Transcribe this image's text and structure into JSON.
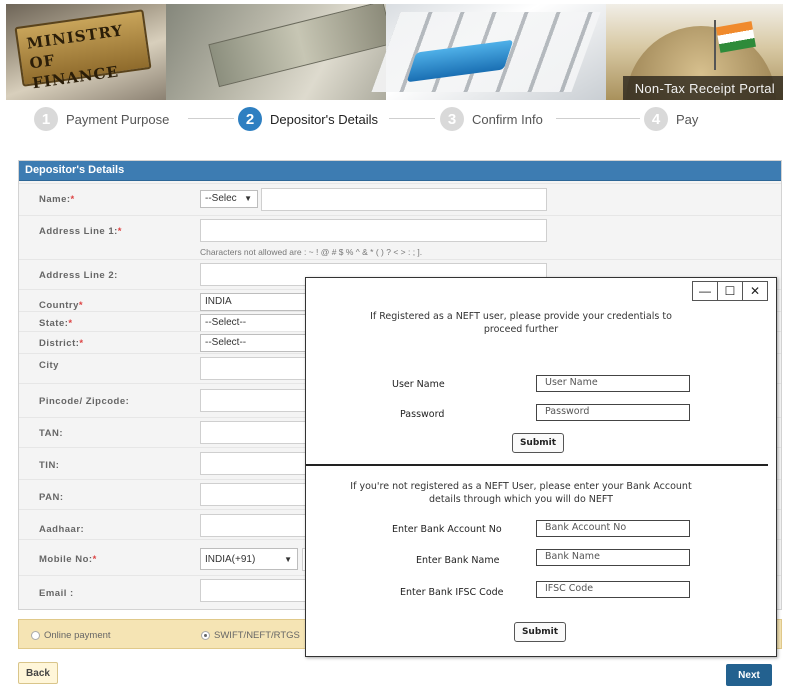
{
  "banner": {
    "plaque_text": "MINISTRY OF FINANCE",
    "portal_title": "Non-Tax Receipt Portal"
  },
  "steps": [
    {
      "number": "1",
      "label": "Payment Purpose",
      "active": false
    },
    {
      "number": "2",
      "label": "Depositor's Details",
      "active": true
    },
    {
      "number": "3",
      "label": "Confirm Info",
      "active": false
    },
    {
      "number": "4",
      "label": "Pay",
      "active": false
    }
  ],
  "form": {
    "header": "Depositor's Details",
    "fields": {
      "name": {
        "label": "Name:",
        "required": "*",
        "select_value": "--Selec"
      },
      "address1": {
        "label": "Address Line 1:",
        "required": "*",
        "hint": "Characters not allowed are : ~ ! @ # $ % ^ & * ( ) ? < > : ; ]."
      },
      "address2": {
        "label": "Address Line 2:"
      },
      "country": {
        "label": "Country",
        "required": "*",
        "value": "INDIA"
      },
      "state": {
        "label": "State:",
        "required": "*",
        "value": "--Select--"
      },
      "district": {
        "label": "District:",
        "required": "*",
        "value": "--Select--"
      },
      "city": {
        "label": "City"
      },
      "pincode": {
        "label": "Pincode/ Zipcode:"
      },
      "tan": {
        "label": "TAN:"
      },
      "tin": {
        "label": "TIN:"
      },
      "pan": {
        "label": "PAN:"
      },
      "aadhaar": {
        "label": "Aadhaar:"
      },
      "mobile": {
        "label": "Mobile No:",
        "required": "*",
        "value": "INDIA(+91)"
      },
      "email": {
        "label": "Email :"
      }
    }
  },
  "payment": {
    "online": "Online payment",
    "swift": "SWIFT/NEFT/RTGS"
  },
  "buttons": {
    "back": "Back",
    "next": "Next"
  },
  "popup": {
    "window_controls": {
      "minimize": "—",
      "maximize": "☐",
      "close": "✕"
    },
    "registered_text_1": "If Registered as a NEFT user, please provide your credentials to",
    "registered_text_2": "proceed further",
    "user_name_label": "User Name",
    "user_name_value": "User Name",
    "password_label": "Password",
    "password_value": "Password",
    "submit_1": "Submit",
    "unregistered_text_1": "If you're not registered as a NEFT User, please enter your Bank Account",
    "unregistered_text_2": "details through which you will do NEFT",
    "bank_account_label": "Enter Bank Account No",
    "bank_account_value": "Bank Account No",
    "bank_name_label": "Enter Bank Name",
    "bank_name_value": "Bank Name",
    "ifsc_label": "Enter Bank IFSC Code",
    "ifsc_value": "IFSC Code",
    "submit_2": "Submit"
  }
}
